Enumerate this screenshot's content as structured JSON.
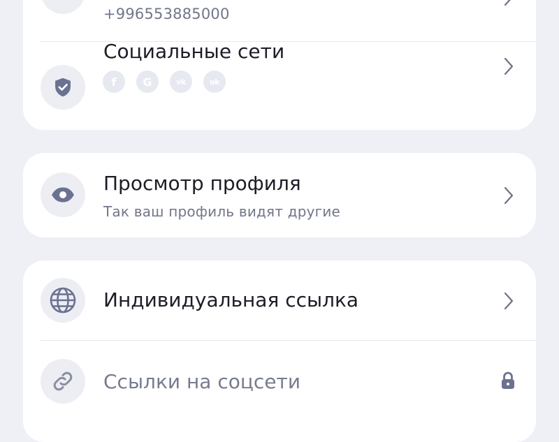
{
  "phone": {
    "value": "+996553885000"
  },
  "social": {
    "title": "Социальные сети",
    "icons": [
      {
        "name": "facebook-icon",
        "glyph": "f"
      },
      {
        "name": "google-icon",
        "glyph": "G"
      },
      {
        "name": "vk-icon",
        "glyph": "vk"
      },
      {
        "name": "odnoklassniki-icon",
        "glyph": "ok"
      }
    ]
  },
  "preview": {
    "title": "Просмотр профиля",
    "subtitle": "Так ваш профиль видят другие"
  },
  "individual_link": {
    "title": "Индивидуальная ссылка"
  },
  "social_links": {
    "title": "Ссылки на соцсети",
    "locked": true
  },
  "colors": {
    "background": "#eef0f5",
    "card": "#ffffff",
    "icon_fill": "#6b7190",
    "icon_circle": "#eceef4",
    "muted_text": "#727689"
  }
}
